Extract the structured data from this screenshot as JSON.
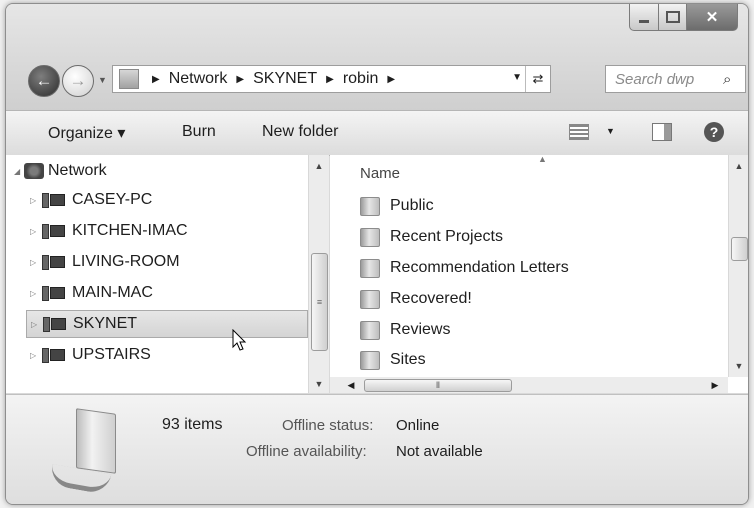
{
  "address": {
    "segments": [
      "Network",
      "SKYNET",
      "robin"
    ]
  },
  "search": {
    "placeholder": "Search dwp"
  },
  "toolbar": {
    "organize": "Organize ▾",
    "burn": "Burn",
    "new_folder": "New folder"
  },
  "tree": {
    "root": "Network",
    "items": [
      "CASEY-PC",
      "KITCHEN-IMAC",
      "LIVING-ROOM",
      "MAIN-MAC",
      "SKYNET",
      "UPSTAIRS"
    ],
    "selected": "SKYNET"
  },
  "files": {
    "column": "Name",
    "items": [
      "Public",
      "Recent Projects",
      "Recommendation Letters",
      "Recovered!",
      "Reviews",
      "Sites"
    ]
  },
  "details": {
    "count": "93 items",
    "status_label": "Offline status:",
    "status_value": "Online",
    "availability_label": "Offline availability:",
    "availability_value": "Not available"
  },
  "icons": [
    "back-icon",
    "forward-icon",
    "refresh-icon",
    "search-icon",
    "view-icon",
    "preview-pane-icon",
    "help-icon",
    "computer-icon",
    "folder-icon",
    "network-icon"
  ],
  "colors": {
    "chrome": "#d9d9d9",
    "selection": "#dadada"
  }
}
